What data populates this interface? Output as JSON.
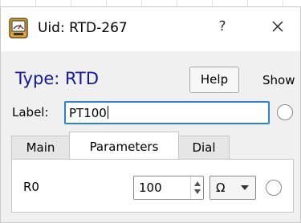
{
  "window": {
    "title": "Uid: RTD-267",
    "help_glyph": "?",
    "icons": {
      "app": "gauge-icon",
      "close": "close-icon"
    }
  },
  "header": {
    "type_title": "Type: RTD",
    "help_label": "Help",
    "show_label": "Show"
  },
  "label_row": {
    "label": "Label:",
    "value": "PT100"
  },
  "tabs": [
    {
      "label": "Main",
      "active": false
    },
    {
      "label": "Parameters",
      "active": true
    },
    {
      "label": "Dial",
      "active": false
    }
  ],
  "parameters": [
    {
      "name": "R0",
      "value": "100",
      "unit": "Ω"
    }
  ],
  "colors": {
    "title_text": "#15159a",
    "focus_border": "#2f7fd3",
    "window_bg": "#f0f0f0"
  }
}
